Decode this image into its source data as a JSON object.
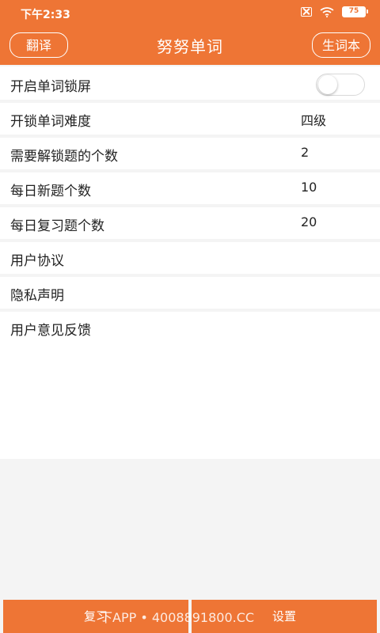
{
  "status": {
    "time": "下午2:33",
    "battery": "75"
  },
  "appbar": {
    "left_button": "翻译",
    "title": "努努单词",
    "right_button": "生词本"
  },
  "settings": [
    {
      "label": "开启单词锁屏",
      "value": null,
      "toggle": false
    },
    {
      "label": "开锁单词难度",
      "value": "四级"
    },
    {
      "label": "需要解锁题的个数",
      "value": "2"
    },
    {
      "label": "每日新题个数",
      "value": "10"
    },
    {
      "label": "每日复习题个数",
      "value": "20"
    },
    {
      "label": "用户协议",
      "value": null
    },
    {
      "label": "隐私声明",
      "value": null
    },
    {
      "label": "用户意见反馈",
      "value": null
    }
  ],
  "tabs": {
    "review": "复习",
    "settings": "设置"
  },
  "watermark": "下APP • 4008891800.CC",
  "colors": {
    "accent": "#ee7535",
    "background": "#f4f4f4"
  }
}
